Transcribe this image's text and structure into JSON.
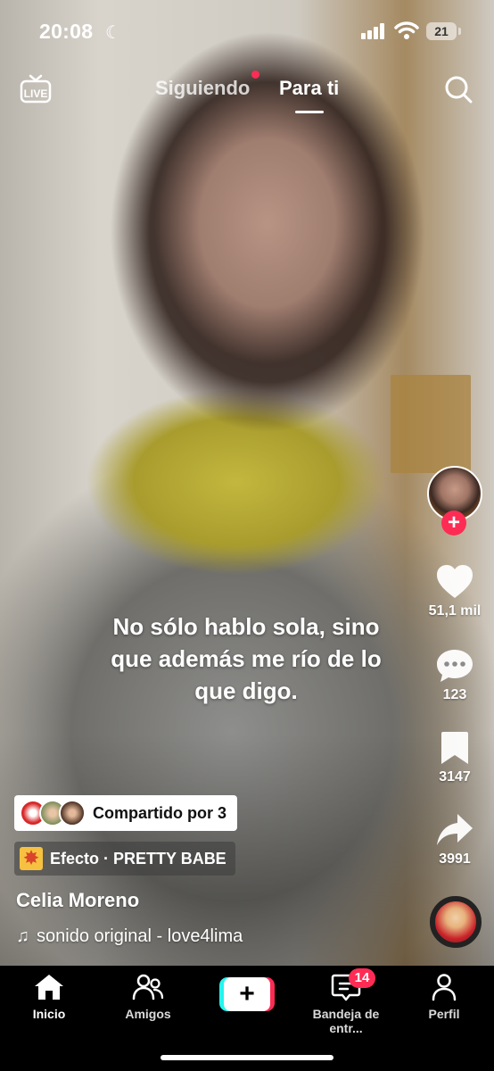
{
  "status_bar": {
    "time": "20:08",
    "battery": "21"
  },
  "top_nav": {
    "live_label": "LIVE",
    "tabs": [
      {
        "label": "Siguiendo",
        "active": false
      },
      {
        "label": "Para ti",
        "active": true
      }
    ]
  },
  "video": {
    "caption": "No sólo hablo sola, sino que además me río de lo que digo."
  },
  "rail": {
    "likes": "51,1 mil",
    "comments": "123",
    "saves": "3147",
    "shares": "3991"
  },
  "post": {
    "shared_by": "Compartido por 3",
    "effect": "Efecto · PRETTY BABE",
    "username": "Celia Moreno",
    "sound": "sonido original - love4lima"
  },
  "bottom_nav": {
    "items": [
      {
        "label": "Inicio"
      },
      {
        "label": "Amigos"
      },
      {
        "label": "Bandeja de entr..."
      },
      {
        "label": "Perfil"
      }
    ],
    "inbox_badge": "14"
  },
  "colors": {
    "accent": "#fe2c55",
    "cyan": "#25f4ee"
  }
}
